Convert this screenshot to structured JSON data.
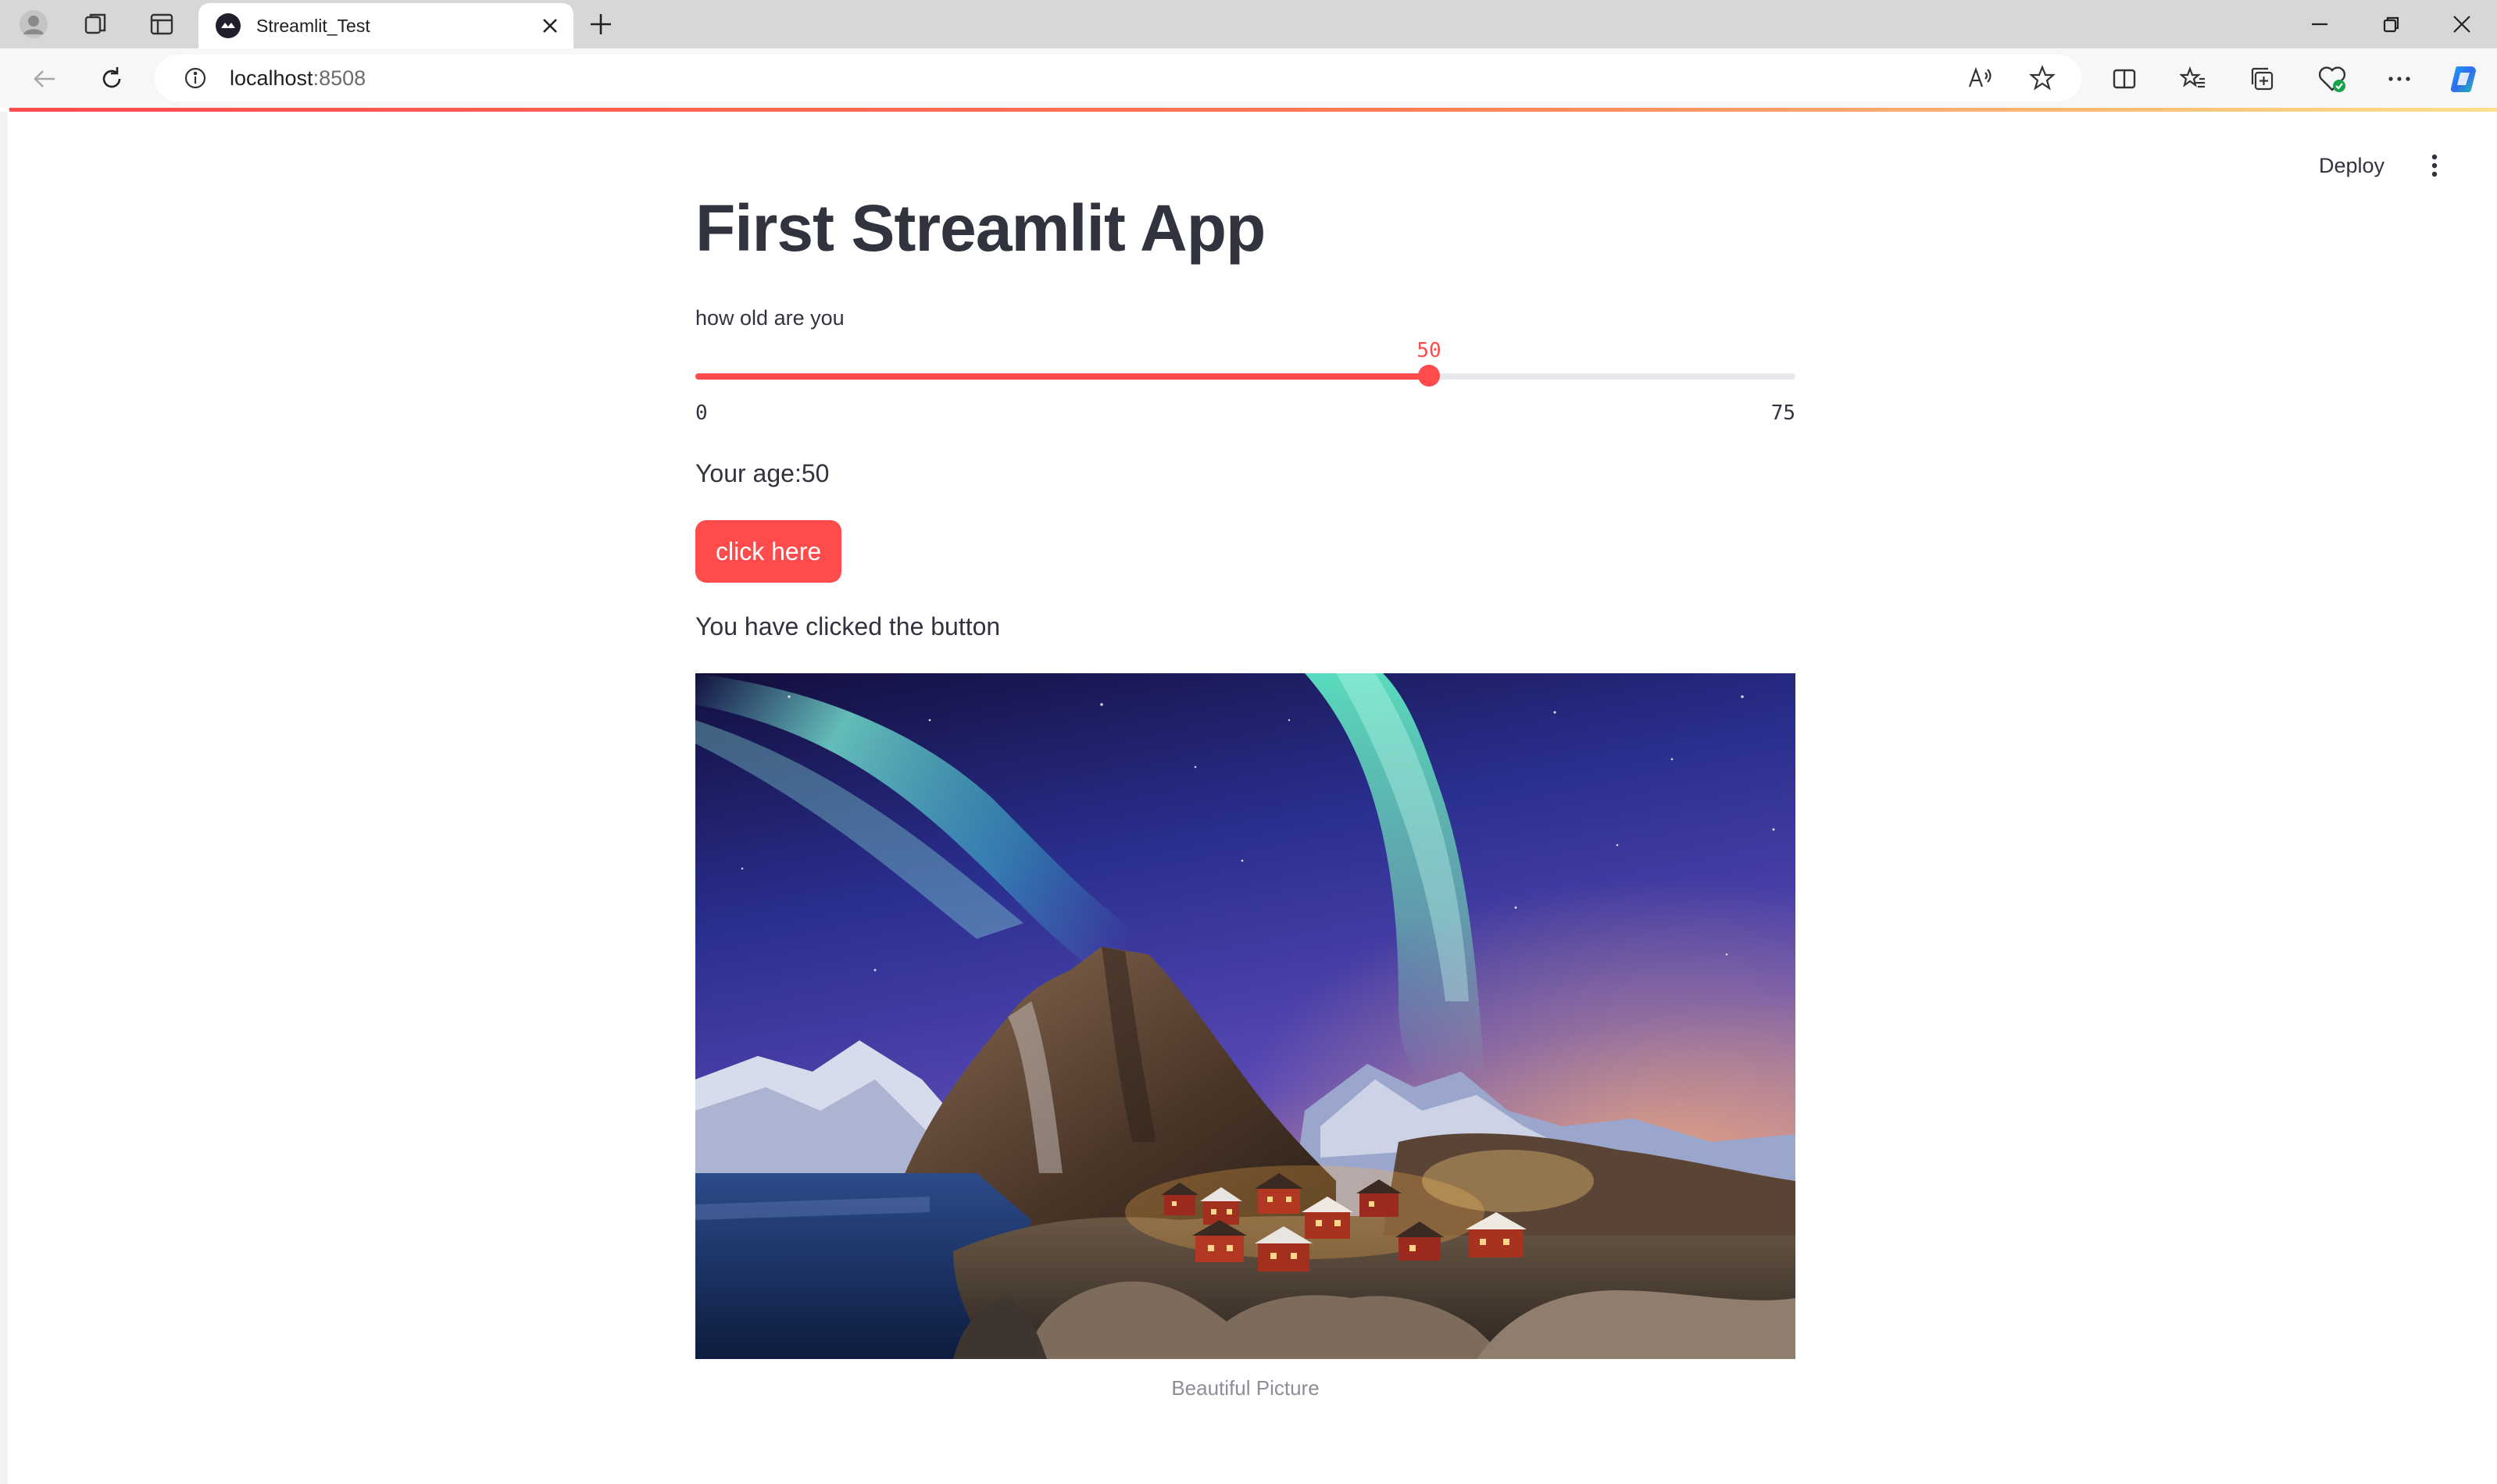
{
  "browser": {
    "tab_title": "Streamlit_Test",
    "url_host": "localhost",
    "url_port": ":8508",
    "icons": [
      "profile-icon",
      "workspaces-icon",
      "tab-actions-icon",
      "streamlit-favicon",
      "close-icon",
      "new-tab-icon",
      "minimize-icon",
      "restore-icon",
      "window-close-icon",
      "back-icon",
      "refresh-icon",
      "info-icon",
      "read-aloud-icon",
      "favorite-star-icon",
      "split-screen-icon",
      "favorites-icon",
      "collections-icon",
      "browser-essentials-icon",
      "more-icon",
      "copilot-icon"
    ]
  },
  "app": {
    "deploy_label": "Deploy",
    "title": "First Streamlit App",
    "slider": {
      "label": "how old are you",
      "value": "50",
      "min": "0",
      "max": "75",
      "fraction": 0.6667
    },
    "age_text": "Your age:50",
    "button_label": "click here",
    "clicked_text": "You have clicked the button",
    "image_caption": "Beautiful Picture"
  },
  "colors": {
    "accent": "#ff4b4b",
    "text": "#31333f",
    "track": "#e6e8ee"
  }
}
